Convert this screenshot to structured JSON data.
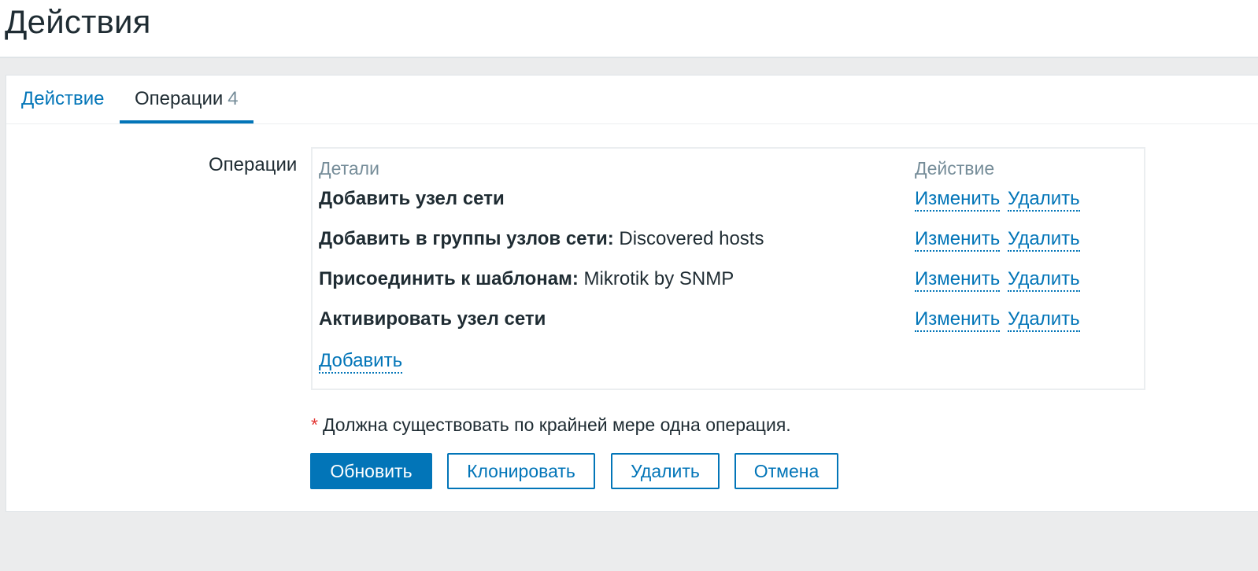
{
  "page": {
    "title": "Действия"
  },
  "tabs": [
    {
      "label": "Действие"
    },
    {
      "label": "Операции",
      "count": "4"
    }
  ],
  "form": {
    "operations_label": "Операции",
    "table": {
      "header_details": "Детали",
      "header_action": "Действие",
      "rows": [
        {
          "bold": "Добавить узел сети",
          "text": "",
          "edit": "Изменить",
          "remove": "Удалить"
        },
        {
          "bold": "Добавить в группы узлов сети:",
          "text": " Discovered hosts",
          "edit": "Изменить",
          "remove": "Удалить"
        },
        {
          "bold": "Присоединить к шаблонам:",
          "text": " Mikrotik by SNMP",
          "edit": "Изменить",
          "remove": "Удалить"
        },
        {
          "bold": "Активировать узел сети",
          "text": "",
          "edit": "Изменить",
          "remove": "Удалить"
        }
      ],
      "add_label": "Добавить"
    },
    "note_asterisk": "*",
    "note": "Должна существовать по крайней мере одна операция."
  },
  "buttons": {
    "update": "Обновить",
    "clone": "Клонировать",
    "delete": "Удалить",
    "cancel": "Отмена"
  },
  "colors": {
    "accent": "#0275b8",
    "text": "#1f2c33",
    "muted": "#768d99",
    "required": "#e33734",
    "background": "#ebeced"
  }
}
